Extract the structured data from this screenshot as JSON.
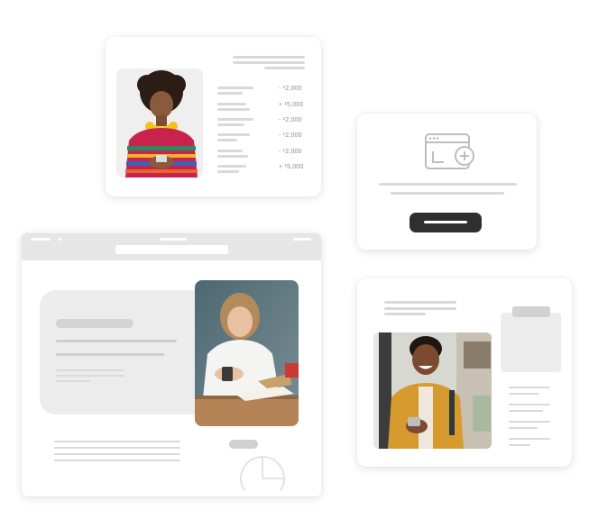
{
  "transactions": [
    {
      "amount": "- ¹2,000"
    },
    {
      "amount": "+ ¹5,000"
    },
    {
      "amount": "- ¹2,000"
    },
    {
      "amount": "- ¹2,000"
    },
    {
      "amount": "- ¹2,000"
    },
    {
      "amount": "+ ¹5,000"
    }
  ],
  "colors": {
    "card_bg": "#ffffff",
    "placeholder": "#d9d9d9",
    "panel": "#ececec",
    "dark_button": "#2f2f2f"
  },
  "icons": [
    "browser-add-icon",
    "pie-chart-icon"
  ]
}
